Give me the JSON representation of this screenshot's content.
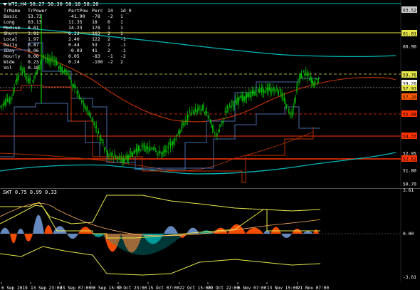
{
  "header": {
    "symbol_line": "WTI,H4  58.27 58.30 58.18 58.20"
  },
  "stats": {
    "columns": [
      "TrName",
      "TrPower",
      "PartPow",
      "Perc",
      "14",
      "1d_0"
    ],
    "rows": [
      [
        "Basic",
        "53.73",
        "-41.90",
        "-78",
        "-2",
        "1"
      ],
      [
        "Long",
        "63.13",
        "11.35",
        "18",
        "0",
        "1"
      ],
      [
        "Medium",
        "8.01",
        "14.23",
        "178",
        "1",
        "1"
      ],
      [
        "Short",
        "3.81",
        "6.22",
        "163",
        "2",
        "1"
      ],
      [
        "Local",
        "1.97",
        "2.40",
        "122",
        "2",
        "-1"
      ],
      [
        "Daily",
        "0.87",
        "0.44",
        "53",
        "2",
        "-1"
      ],
      [
        "IDay",
        "0.06",
        "-0.03",
        "41",
        "2",
        "-1"
      ],
      [
        "Hourly",
        "0.06",
        "0.05",
        "-83",
        "-1",
        "-2"
      ],
      [
        "Wide",
        "0.23",
        "0.24",
        "-100",
        "-2",
        "2"
      ],
      [
        "Vol",
        "0.10",
        "",
        "",
        "",
        ""
      ]
    ]
  },
  "price_axis": {
    "labels": [
      "63.52",
      "61.81",
      "60.90",
      "59.76",
      "59.20",
      "57.93",
      "57.20",
      "55.88",
      "54.37",
      "52.95",
      "52.62",
      "51.80",
      "50.70"
    ]
  },
  "price_axis_highlights": [
    {
      "text": "63.52",
      "bg": "#c8c8c8",
      "fg": "#000000"
    },
    {
      "text": "61.81",
      "bg": "#e6e64b",
      "fg": "#000000"
    },
    {
      "text": "59.76",
      "bg": "#e6e64b",
      "fg": "#000000"
    },
    {
      "text": "59.20",
      "bg": "#ffffff",
      "fg": "#000000"
    },
    {
      "text": "57.93",
      "bg": "#e6e64b",
      "fg": "#000000"
    },
    {
      "text": "57.20",
      "bg": "#ff5a00",
      "fg": "#000000"
    },
    {
      "text": "55.88",
      "bg": "#ff3300",
      "fg": "#000000"
    },
    {
      "text": "54.37",
      "bg": "#ff3300",
      "fg": "#000000"
    },
    {
      "text": "52.62",
      "bg": "#ff3300",
      "fg": "#000000"
    }
  ],
  "swt": {
    "label": "SWT 0.75 0.99 0.33",
    "axis_labels": [
      "3.61",
      "0.00",
      "-3.61"
    ]
  },
  "time_axis": {
    "labels": [
      "6 Sep 2019",
      "13 Sep 23:00",
      "23 Sep 07:00",
      "30 Sep 15:00",
      "7 Oct 23:00",
      "15 Oct 07:00",
      "22 Oct 15:00",
      "29 Oct 22:00",
      "6 Nov 07:00",
      "13 Nov 15:00",
      "21 Nov 07:00"
    ]
  },
  "colors": {
    "background": "#000000",
    "candle": "#00c800",
    "cyan_ma": "#00b4b4",
    "red_ma": "#c83200",
    "blue_band": "#4a6aa8",
    "yellow": "#e6e64b",
    "orange_fill": "#ff5000",
    "steelblue_fill": "#6a8fc8",
    "teal_fill": "#00a0a0"
  }
}
